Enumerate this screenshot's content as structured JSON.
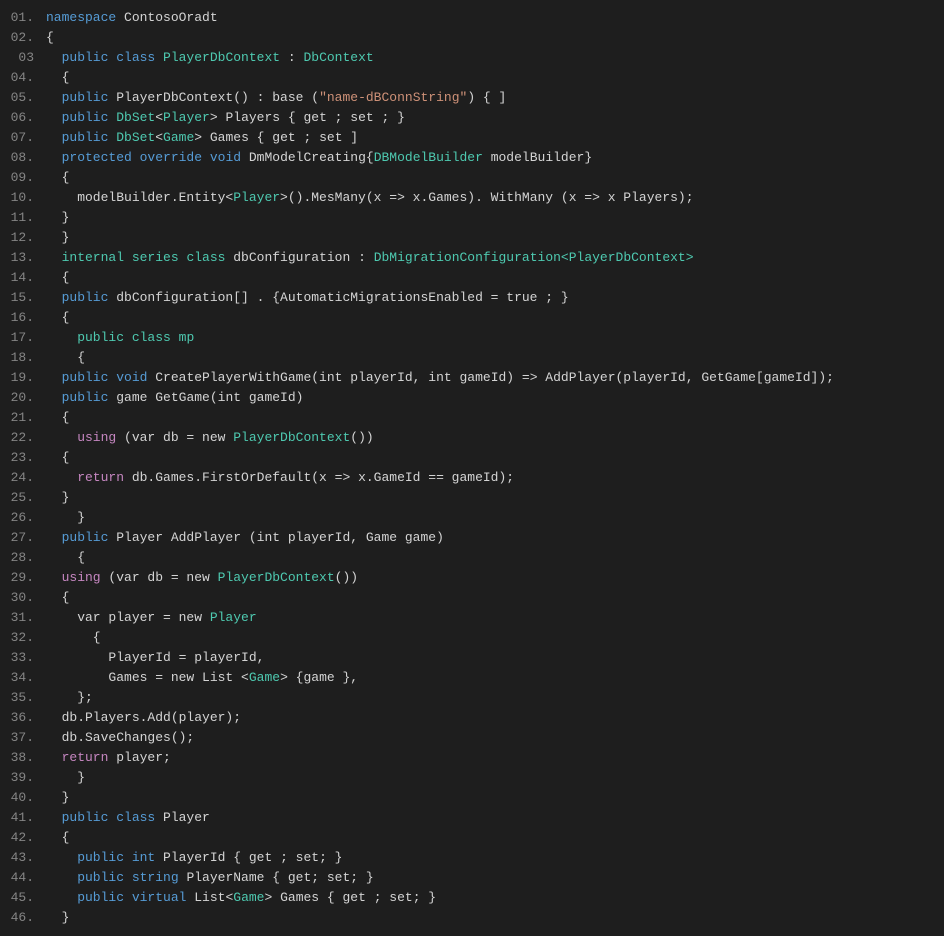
{
  "editor": {
    "background": "#1e1e1e",
    "lines": [
      {
        "num": "01.",
        "tokens": [
          {
            "t": "namespace",
            "c": "kw"
          },
          {
            "t": " ContosoOradt",
            "c": "plain"
          }
        ]
      },
      {
        "num": "02.",
        "tokens": [
          {
            "t": "{",
            "c": "plain"
          }
        ]
      },
      {
        "num": "03",
        "tokens": [
          {
            "t": "  public ",
            "c": "kw"
          },
          {
            "t": "class ",
            "c": "kw"
          },
          {
            "t": "PlayerDbContext",
            "c": "link"
          },
          {
            "t": " : ",
            "c": "plain"
          },
          {
            "t": "DbContext",
            "c": "link"
          }
        ]
      },
      {
        "num": "04.",
        "tokens": [
          {
            "t": "  {",
            "c": "plain"
          }
        ]
      },
      {
        "num": "05.",
        "tokens": [
          {
            "t": "  public ",
            "c": "kw"
          },
          {
            "t": "PlayerDbContext",
            "c": "plain"
          },
          {
            "t": "() : base (",
            "c": "plain"
          },
          {
            "t": "\"name-dBConnString\"",
            "c": "str"
          },
          {
            "t": ") { ]",
            "c": "plain"
          }
        ]
      },
      {
        "num": "06.",
        "tokens": [
          {
            "t": "  public ",
            "c": "kw"
          },
          {
            "t": "DbSet",
            "c": "link"
          },
          {
            "t": "<",
            "c": "plain"
          },
          {
            "t": "Player",
            "c": "link"
          },
          {
            "t": "> Players { get ; set ; }",
            "c": "plain"
          }
        ]
      },
      {
        "num": "07.",
        "tokens": [
          {
            "t": "  public ",
            "c": "kw"
          },
          {
            "t": "DbSet",
            "c": "link"
          },
          {
            "t": "<",
            "c": "plain"
          },
          {
            "t": "Game",
            "c": "link"
          },
          {
            "t": "> Games { get ; set ]",
            "c": "plain"
          }
        ]
      },
      {
        "num": "08.",
        "tokens": [
          {
            "t": "  protected ",
            "c": "kw"
          },
          {
            "t": "override ",
            "c": "kw"
          },
          {
            "t": "void ",
            "c": "kw"
          },
          {
            "t": "DmModelCreating{",
            "c": "plain"
          },
          {
            "t": "DBModelBuilder",
            "c": "link"
          },
          {
            "t": " modelBuilder}",
            "c": "plain"
          }
        ]
      },
      {
        "num": "09.",
        "tokens": [
          {
            "t": "  {",
            "c": "plain"
          }
        ]
      },
      {
        "num": "10.",
        "tokens": [
          {
            "t": "    modelBuilder.Entity<",
            "c": "plain"
          },
          {
            "t": "Player",
            "c": "link"
          },
          {
            "t": ">().MesMany(x => x.Games). WithMany (x => x Players);",
            "c": "plain"
          }
        ]
      },
      {
        "num": "11.",
        "tokens": [
          {
            "t": "  }",
            "c": "plain"
          }
        ]
      },
      {
        "num": "12.",
        "tokens": [
          {
            "t": "  }",
            "c": "plain"
          }
        ]
      },
      {
        "num": "13.",
        "tokens": [
          {
            "t": "  internal ",
            "c": "link"
          },
          {
            "t": "series ",
            "c": "link"
          },
          {
            "t": "class ",
            "c": "link"
          },
          {
            "t": "dbConfiguration",
            "c": "plain"
          },
          {
            "t": " : ",
            "c": "plain"
          },
          {
            "t": "DbMigrationConfiguration<PlayerDbContext>",
            "c": "link"
          }
        ]
      },
      {
        "num": "14.",
        "tokens": [
          {
            "t": "  {",
            "c": "plain"
          }
        ]
      },
      {
        "num": "15.",
        "tokens": [
          {
            "t": "  public ",
            "c": "kw"
          },
          {
            "t": "dbConfiguration[] . {AutomaticMigrationsEnabled = true ; }",
            "c": "plain"
          }
        ]
      },
      {
        "num": "16.",
        "tokens": [
          {
            "t": "  {",
            "c": "plain"
          }
        ]
      },
      {
        "num": "17.",
        "tokens": [
          {
            "t": "    public ",
            "c": "link"
          },
          {
            "t": "class ",
            "c": "link"
          },
          {
            "t": "mp",
            "c": "link"
          }
        ]
      },
      {
        "num": "18.",
        "tokens": [
          {
            "t": "    {",
            "c": "plain"
          }
        ]
      },
      {
        "num": "19.",
        "tokens": [
          {
            "t": "  public ",
            "c": "kw"
          },
          {
            "t": "void ",
            "c": "kw"
          },
          {
            "t": "CreatePlayerWithGame(int playerId, int gameId) => AddPlayer(playerId, GetGame[gameId]);",
            "c": "plain"
          }
        ]
      },
      {
        "num": "20.",
        "tokens": [
          {
            "t": "  public ",
            "c": "kw"
          },
          {
            "t": "game ",
            "c": "plain"
          },
          {
            "t": "GetGame(int gameId)",
            "c": "plain"
          }
        ]
      },
      {
        "num": "21.",
        "tokens": [
          {
            "t": "  {",
            "c": "plain"
          }
        ]
      },
      {
        "num": "22.",
        "tokens": [
          {
            "t": "    using ",
            "c": "kw2"
          },
          {
            "t": "(var db = new ",
            "c": "plain"
          },
          {
            "t": "PlayerDbContext",
            "c": "link"
          },
          {
            "t": "())",
            "c": "plain"
          }
        ]
      },
      {
        "num": "23.",
        "tokens": [
          {
            "t": "  {",
            "c": "plain"
          }
        ]
      },
      {
        "num": "24.",
        "tokens": [
          {
            "t": "    return ",
            "c": "kw2"
          },
          {
            "t": "db.Games.FirstOrDefault(x => x.GameId == gameId);",
            "c": "plain"
          }
        ]
      },
      {
        "num": "25.",
        "tokens": [
          {
            "t": "  }",
            "c": "plain"
          }
        ]
      },
      {
        "num": "26.",
        "tokens": [
          {
            "t": "    }",
            "c": "plain"
          }
        ]
      },
      {
        "num": "27.",
        "tokens": [
          {
            "t": "  public ",
            "c": "kw"
          },
          {
            "t": "Player ",
            "c": "plain"
          },
          {
            "t": "AddPlayer (int playerId, Game game)",
            "c": "plain"
          }
        ]
      },
      {
        "num": "28.",
        "tokens": [
          {
            "t": "    {",
            "c": "plain"
          }
        ]
      },
      {
        "num": "29.",
        "tokens": [
          {
            "t": "  using ",
            "c": "kw2"
          },
          {
            "t": "(var db = new ",
            "c": "plain"
          },
          {
            "t": "PlayerDbContext",
            "c": "link"
          },
          {
            "t": "())",
            "c": "plain"
          }
        ]
      },
      {
        "num": "30.",
        "tokens": [
          {
            "t": "  {",
            "c": "plain"
          }
        ]
      },
      {
        "num": "31.",
        "tokens": [
          {
            "t": "    var player = new ",
            "c": "plain"
          },
          {
            "t": "Player",
            "c": "link"
          }
        ]
      },
      {
        "num": "32.",
        "tokens": [
          {
            "t": "      {",
            "c": "plain"
          }
        ]
      },
      {
        "num": "33.",
        "tokens": [
          {
            "t": "        PlayerId = playerId,",
            "c": "plain"
          }
        ]
      },
      {
        "num": "34.",
        "tokens": [
          {
            "t": "        Games = new List <",
            "c": "plain"
          },
          {
            "t": "Game",
            "c": "link"
          },
          {
            "t": "> {game },",
            "c": "plain"
          }
        ]
      },
      {
        "num": "35.",
        "tokens": [
          {
            "t": "    };",
            "c": "plain"
          }
        ]
      },
      {
        "num": "36.",
        "tokens": [
          {
            "t": "  db.Players.Add(player);",
            "c": "plain"
          }
        ]
      },
      {
        "num": "37.",
        "tokens": [
          {
            "t": "  db.SaveChanges();",
            "c": "plain"
          }
        ]
      },
      {
        "num": "38.",
        "tokens": [
          {
            "t": "  return ",
            "c": "kw2"
          },
          {
            "t": "player;",
            "c": "plain"
          }
        ]
      },
      {
        "num": "39.",
        "tokens": [
          {
            "t": "    }",
            "c": "plain"
          }
        ]
      },
      {
        "num": "40.",
        "tokens": [
          {
            "t": "  }",
            "c": "plain"
          }
        ]
      },
      {
        "num": "41.",
        "tokens": [
          {
            "t": "  public ",
            "c": "kw"
          },
          {
            "t": "class ",
            "c": "kw"
          },
          {
            "t": "Player",
            "c": "plain"
          }
        ]
      },
      {
        "num": "42.",
        "tokens": [
          {
            "t": "  {",
            "c": "plain"
          }
        ]
      },
      {
        "num": "43.",
        "tokens": [
          {
            "t": "    public ",
            "c": "kw"
          },
          {
            "t": "int ",
            "c": "kw"
          },
          {
            "t": "PlayerId { get ; set; }",
            "c": "plain"
          }
        ]
      },
      {
        "num": "44.",
        "tokens": [
          {
            "t": "    public ",
            "c": "kw"
          },
          {
            "t": "string ",
            "c": "kw"
          },
          {
            "t": "PlayerName { get; set; }",
            "c": "plain"
          }
        ]
      },
      {
        "num": "45.",
        "tokens": [
          {
            "t": "    public ",
            "c": "kw"
          },
          {
            "t": "virtual ",
            "c": "kw"
          },
          {
            "t": "List<",
            "c": "plain"
          },
          {
            "t": "Game",
            "c": "link"
          },
          {
            "t": "> Games { get ; set; }",
            "c": "plain"
          }
        ]
      },
      {
        "num": "46.",
        "tokens": [
          {
            "t": "  }",
            "c": "plain"
          }
        ]
      }
    ]
  }
}
